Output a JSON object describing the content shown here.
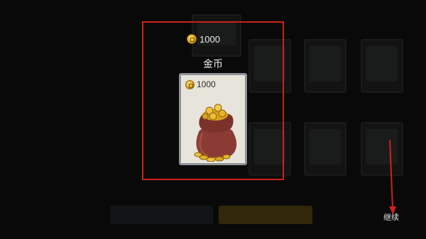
{
  "reward": {
    "amount_header": "1000",
    "title": "金币",
    "card_amount": "1000",
    "icon": "gold-coin-icon",
    "image": "coin-bag"
  },
  "continue": {
    "label": "继续"
  },
  "colors": {
    "highlight": "#d0201c",
    "coin_gold": "#d9a51e",
    "bag_red": "#8a3c34"
  }
}
